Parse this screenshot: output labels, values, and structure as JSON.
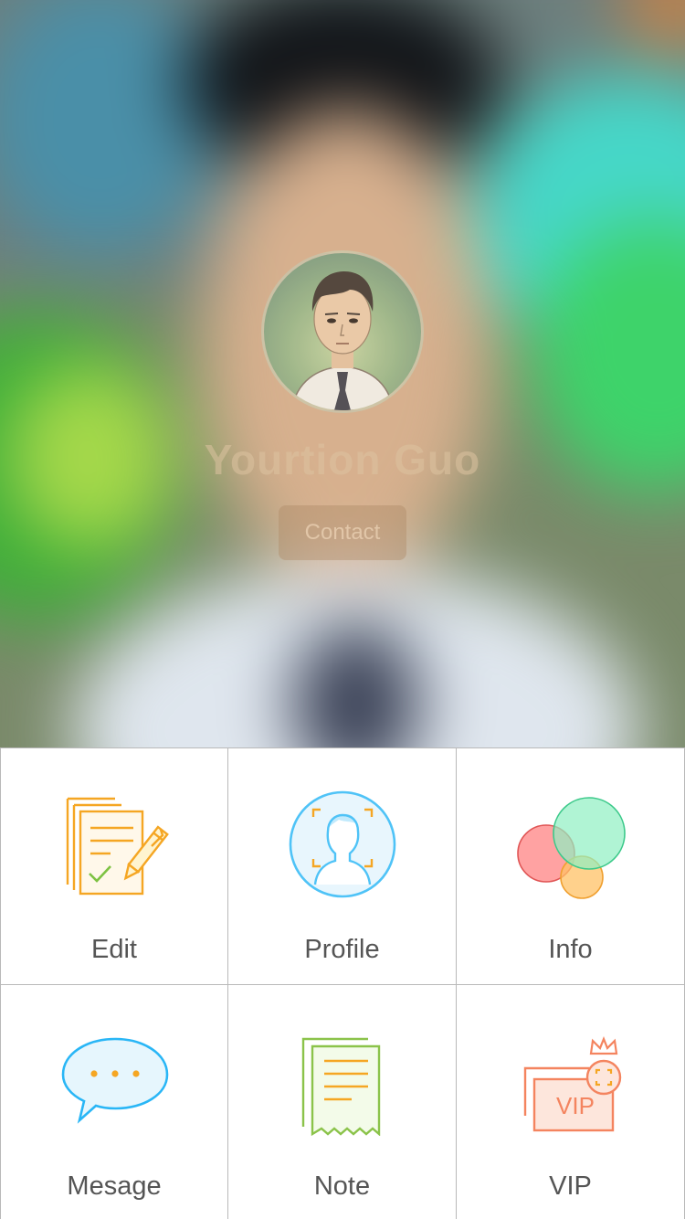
{
  "profile": {
    "name": "Yourtion Guo",
    "contact_label": "Contact"
  },
  "menu": {
    "items": [
      {
        "label": "Edit",
        "icon": "edit-document-icon"
      },
      {
        "label": "Profile",
        "icon": "profile-avatar-icon"
      },
      {
        "label": "Info",
        "icon": "info-circles-icon"
      },
      {
        "label": "Mesage",
        "icon": "message-bubble-icon"
      },
      {
        "label": "Note",
        "icon": "note-receipt-icon"
      },
      {
        "label": "VIP",
        "icon": "vip-card-crown-icon"
      }
    ]
  },
  "colors": {
    "edit_icon": "#f5a623",
    "profile_icon": "#4fc3f7",
    "message_icon": "#29b6f6",
    "note_icon": "#8bc34a",
    "vip_icon": "#f4845f",
    "divider": "#b9b9b9",
    "label_text": "#555555"
  }
}
